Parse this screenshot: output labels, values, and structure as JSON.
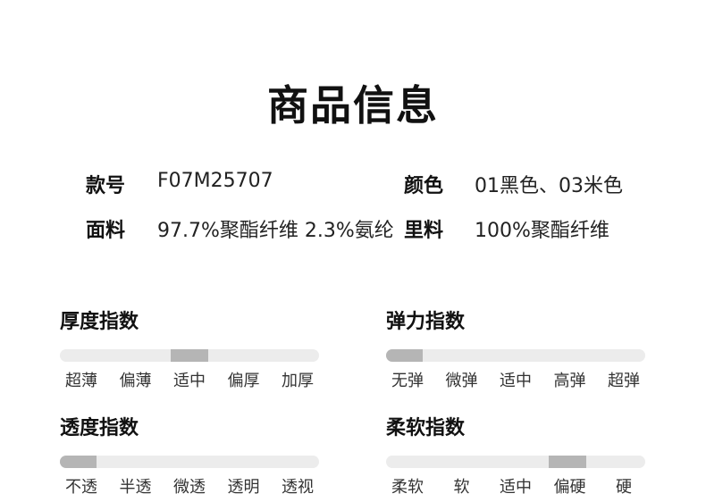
{
  "title": "商品信息",
  "info": {
    "style_no": {
      "label": "款号",
      "value": "F07M25707"
    },
    "color": {
      "label": "颜色",
      "value": "01黑色、03米色"
    },
    "fabric": {
      "label": "面料",
      "value": "97.7%聚酯纤维 2.3%氨纶"
    },
    "lining": {
      "label": "里料",
      "value": "100%聚酯纤维"
    }
  },
  "indices": {
    "thickness": {
      "title": "厚度指数",
      "labels": [
        "超薄",
        "偏薄",
        "适中",
        "偏厚",
        "加厚"
      ],
      "selected_index": 2
    },
    "elasticity": {
      "title": "弹力指数",
      "labels": [
        "无弹",
        "微弹",
        "适中",
        "高弹",
        "超弹"
      ],
      "selected_index": 0
    },
    "transparency": {
      "title": "透度指数",
      "labels": [
        "不透",
        "半透",
        "微透",
        "透明",
        "透视"
      ],
      "selected_index": 0
    },
    "softness": {
      "title": "柔软指数",
      "labels": [
        "柔软",
        "软",
        "适中",
        "偏硬",
        "硬"
      ],
      "selected_index": 3
    }
  },
  "colors": {
    "track": "#ececec",
    "fill": "#b5b5b5"
  }
}
